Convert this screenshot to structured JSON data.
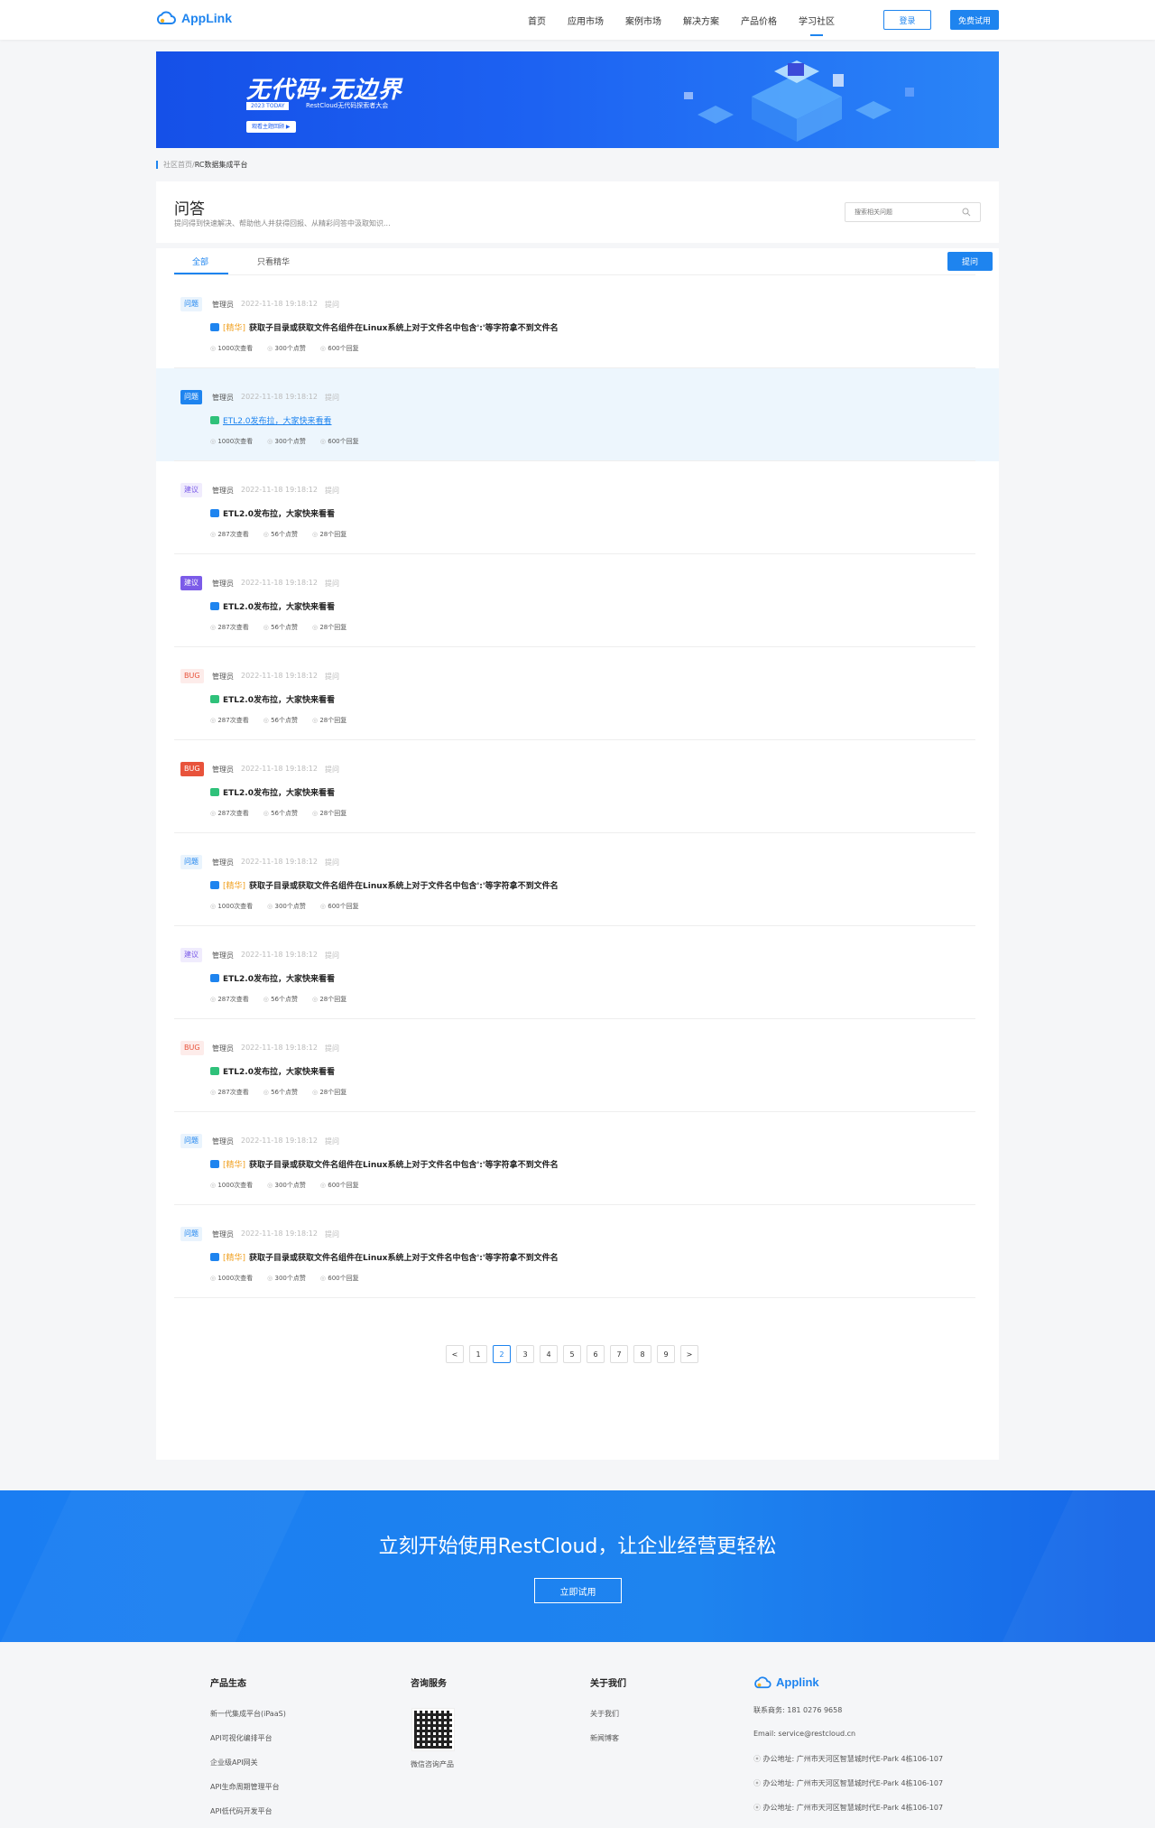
{
  "header": {
    "logo": "AppLink",
    "nav": [
      "首页",
      "应用市场",
      "案例市场",
      "解决方案",
      "产品价格",
      "学习社区"
    ],
    "login": "登录",
    "trial": "免费试用"
  },
  "banner": {
    "title": "无代码·无边界",
    "tag": "2023 TODAY",
    "subtitle": "RestCloud无代码探索者大会",
    "cta": "观看主题回顾 ▶"
  },
  "breadcrumb": {
    "home": "社区首页",
    "sep": " / ",
    "current": "RC数据集成平台"
  },
  "page": {
    "title": "问答",
    "desc": "提问得到快速解决、帮助他人并获得回报、从精彩问答中汲取知识...",
    "search_placeholder": "搜索相关问题"
  },
  "tabs": {
    "all": "全部",
    "elite": "只看精华",
    "ask": "提问"
  },
  "questions": [
    {
      "badge": "问题",
      "author": "管理员",
      "time": "2022-11-18 19:18:12",
      "action": "提问",
      "elite": "[精华]",
      "title": "获取子目录或获取文件名组件在Linux系统上对于文件名中包含':'等字符拿不到文件名",
      "views": "1000次查看",
      "likes": "300个点赞",
      "replies": "600个回复"
    },
    {
      "badge": "问题",
      "author": "管理员",
      "time": "2022-11-18 19:18:12",
      "action": "提问",
      "elite": "",
      "title": "ETL2.0发布拉，大家快来看看",
      "views": "1000次查看",
      "likes": "300个点赞",
      "replies": "600个回复"
    },
    {
      "badge": "建议",
      "author": "管理员",
      "time": "2022-11-18 19:18:12",
      "action": "提问",
      "elite": "",
      "title": "ETL2.0发布拉，大家快来看看",
      "views": "287次查看",
      "likes": "56个点赞",
      "replies": "28个回复"
    },
    {
      "badge": "建议",
      "author": "管理员",
      "time": "2022-11-18 19:18:12",
      "action": "提问",
      "elite": "",
      "title": "ETL2.0发布拉，大家快来看看",
      "views": "287次查看",
      "likes": "56个点赞",
      "replies": "28个回复"
    },
    {
      "badge": "BUG",
      "author": "管理员",
      "time": "2022-11-18 19:18:12",
      "action": "提问",
      "elite": "",
      "title": "ETL2.0发布拉，大家快来看看",
      "views": "287次查看",
      "likes": "56个点赞",
      "replies": "28个回复"
    },
    {
      "badge": "BUG",
      "author": "管理员",
      "time": "2022-11-18 19:18:12",
      "action": "提问",
      "elite": "",
      "title": "ETL2.0发布拉，大家快来看看",
      "views": "287次查看",
      "likes": "56个点赞",
      "replies": "28个回复"
    },
    {
      "badge": "问题",
      "author": "管理员",
      "time": "2022-11-18 19:18:12",
      "action": "提问",
      "elite": "[精华]",
      "title": "获取子目录或获取文件名组件在Linux系统上对于文件名中包含':'等字符拿不到文件名",
      "views": "1000次查看",
      "likes": "300个点赞",
      "replies": "600个回复"
    },
    {
      "badge": "建议",
      "author": "管理员",
      "time": "2022-11-18 19:18:12",
      "action": "提问",
      "elite": "",
      "title": "ETL2.0发布拉，大家快来看看",
      "views": "287次查看",
      "likes": "56个点赞",
      "replies": "28个回复"
    },
    {
      "badge": "BUG",
      "author": "管理员",
      "time": "2022-11-18 19:18:12",
      "action": "提问",
      "elite": "",
      "title": "ETL2.0发布拉，大家快来看看",
      "views": "287次查看",
      "likes": "56个点赞",
      "replies": "28个回复"
    },
    {
      "badge": "问题",
      "author": "管理员",
      "time": "2022-11-18 19:18:12",
      "action": "提问",
      "elite": "[精华]",
      "title": "获取子目录或获取文件名组件在Linux系统上对于文件名中包含':'等字符拿不到文件名",
      "views": "1000次查看",
      "likes": "300个点赞",
      "replies": "600个回复"
    },
    {
      "badge": "问题",
      "author": "管理员",
      "time": "2022-11-18 19:18:12",
      "action": "提问",
      "elite": "[精华]",
      "title": "获取子目录或获取文件名组件在Linux系统上对于文件名中包含':'等字符拿不到文件名",
      "views": "1000次查看",
      "likes": "300个点赞",
      "replies": "600个回复"
    }
  ],
  "pagination": {
    "prev": "<",
    "pages": [
      "1",
      "2",
      "3",
      "4",
      "5",
      "6",
      "7",
      "8",
      "9"
    ],
    "current": "2",
    "next": ">"
  },
  "cta": {
    "title": "立刻开始使用RestCloud，让企业经营更轻松",
    "button": "立即试用"
  },
  "footer": {
    "products": {
      "title": "产品生态",
      "items": [
        "新一代集成平台(iPaaS)",
        "API可视化编排平台",
        "企业级API网关",
        "API生命周期管理平台",
        "API低代码开发平台"
      ]
    },
    "consult": {
      "title": "咨询服务",
      "qr_caption": "微信咨询产品"
    },
    "about": {
      "title": "关于我们",
      "items": [
        "关于我们",
        "新闻博客"
      ]
    },
    "contact": {
      "logo": "Applink",
      "phone": "联系商务: 181 0276 9658",
      "email": "Email: service@restcloud.cn",
      "addresses": [
        "办公地址: 广州市天河区智慧城时代E-Park 4栋106-107",
        "办公地址: 广州市天河区智慧城时代E-Park 4栋106-107",
        "办公地址: 广州市天河区智慧城时代E-Park 4栋106-107"
      ]
    }
  }
}
